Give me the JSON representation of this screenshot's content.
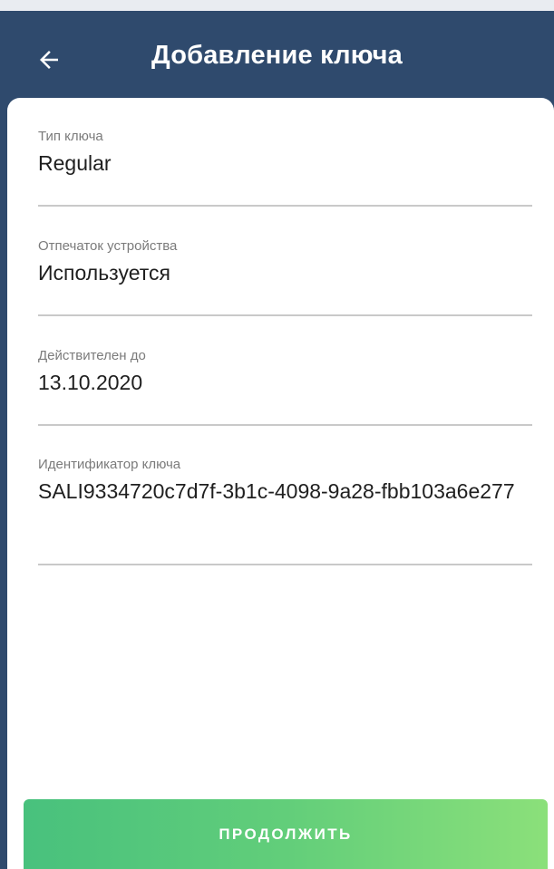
{
  "header": {
    "title": "Добавление ключа",
    "back_icon": "arrow-left-icon"
  },
  "fields": [
    {
      "label": "Тип ключа",
      "value": "Regular"
    },
    {
      "label": "Отпечаток устройства",
      "value": "Используется"
    },
    {
      "label": "Действителен до",
      "value": "13.10.2020"
    },
    {
      "label": "Идентификатор ключа",
      "value": "SALI9334720c7d7f-3b1c-4098-9a28-fbb103a6e277"
    }
  ],
  "actions": {
    "continue_label": "ПРОДОЛЖИТЬ"
  },
  "colors": {
    "header_bg": "#2f4a6d",
    "button_gradient_start": "#48c17d",
    "button_gradient_end": "#8be07a"
  }
}
